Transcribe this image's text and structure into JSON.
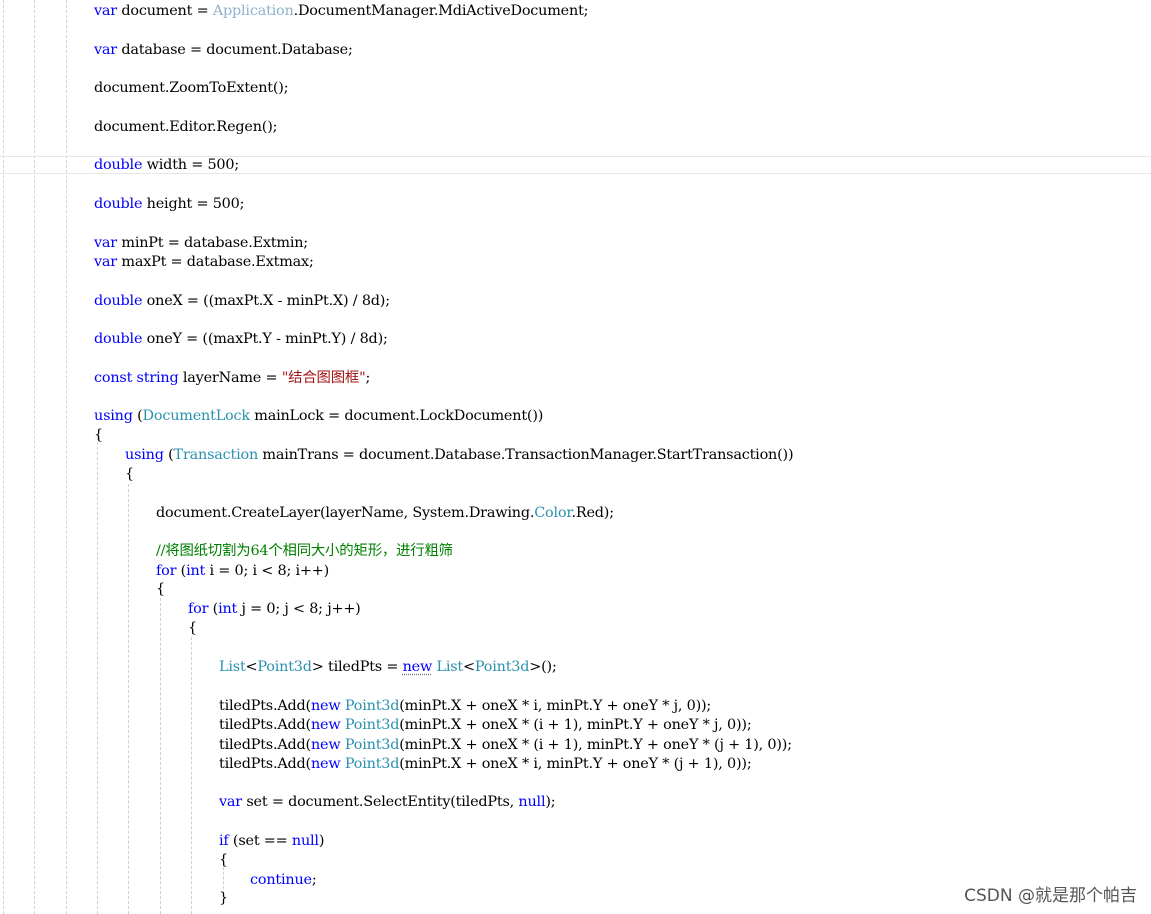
{
  "editor": {
    "lines": [
      {
        "id": "l0",
        "tokens": [
          {
            "t": "var",
            "c": "kw"
          },
          {
            "t": " document = "
          },
          {
            "t": "Application",
            "c": "type-light"
          },
          {
            "t": ".DocumentManager.MdiActiveDocument;"
          }
        ]
      },
      {
        "id": "l1",
        "tokens": [
          {
            "t": "var",
            "c": "kw"
          },
          {
            "t": " database = document.Database;"
          }
        ]
      },
      {
        "id": "l2",
        "tokens": [
          {
            "t": "document.ZoomToExtent();"
          }
        ]
      },
      {
        "id": "l3",
        "tokens": [
          {
            "t": "document.Editor.Regen();"
          }
        ]
      },
      {
        "id": "l4",
        "tokens": [
          {
            "t": "double",
            "c": "kw"
          },
          {
            "t": " width = 500;"
          }
        ]
      },
      {
        "id": "l5",
        "tokens": [
          {
            "t": "double",
            "c": "kw"
          },
          {
            "t": " height = 500;"
          }
        ]
      },
      {
        "id": "l6",
        "tokens": [
          {
            "t": "var",
            "c": "kw"
          },
          {
            "t": " minPt = database.Extmin;"
          }
        ]
      },
      {
        "id": "l7",
        "tokens": [
          {
            "t": "var",
            "c": "kw"
          },
          {
            "t": " maxPt = database.Extmax;"
          }
        ]
      },
      {
        "id": "l8",
        "tokens": [
          {
            "t": "double",
            "c": "kw"
          },
          {
            "t": " oneX = ((maxPt.X - minPt.X) / 8d);"
          }
        ]
      },
      {
        "id": "l9",
        "tokens": [
          {
            "t": "double",
            "c": "kw"
          },
          {
            "t": " oneY = ((maxPt.Y - minPt.Y) / 8d);"
          }
        ]
      },
      {
        "id": "l10",
        "tokens": [
          {
            "t": "const",
            "c": "kw"
          },
          {
            "t": " "
          },
          {
            "t": "string",
            "c": "kw"
          },
          {
            "t": " layerName = "
          },
          {
            "t": "\"结合图图框\"",
            "c": "str"
          },
          {
            "t": ";"
          }
        ]
      },
      {
        "id": "l11",
        "tokens": [
          {
            "t": "using",
            "c": "kw"
          },
          {
            "t": " ("
          },
          {
            "t": "DocumentLock",
            "c": "type"
          },
          {
            "t": " mainLock = document.LockDocument())"
          }
        ]
      },
      {
        "id": "l12",
        "tokens": [
          {
            "t": "{"
          }
        ]
      },
      {
        "id": "l13",
        "tokens": [
          {
            "t": "using",
            "c": "kw"
          },
          {
            "t": " ("
          },
          {
            "t": "Transaction",
            "c": "type"
          },
          {
            "t": " mainTrans = document.Database.TransactionManager.StartTransaction())"
          }
        ]
      },
      {
        "id": "l14",
        "tokens": [
          {
            "t": "{"
          }
        ]
      },
      {
        "id": "l15",
        "tokens": [
          {
            "t": "document.CreateLayer(layerName, System.Drawing."
          },
          {
            "t": "Color",
            "c": "type"
          },
          {
            "t": ".Red);"
          }
        ]
      },
      {
        "id": "l16",
        "tokens": [
          {
            "t": "//将图纸切割为64个相同大小的矩形，进行粗筛",
            "c": "comment"
          }
        ]
      },
      {
        "id": "l17",
        "tokens": [
          {
            "t": "for",
            "c": "kw"
          },
          {
            "t": " ("
          },
          {
            "t": "int",
            "c": "kw"
          },
          {
            "t": " i = 0; i < 8; i++)"
          }
        ]
      },
      {
        "id": "l18",
        "tokens": [
          {
            "t": "{"
          }
        ]
      },
      {
        "id": "l19",
        "tokens": [
          {
            "t": "for",
            "c": "kw"
          },
          {
            "t": " ("
          },
          {
            "t": "int",
            "c": "kw"
          },
          {
            "t": " j = 0; j < 8; j++)"
          }
        ]
      },
      {
        "id": "l20",
        "tokens": [
          {
            "t": "{"
          }
        ]
      },
      {
        "id": "l21",
        "tokens": [
          {
            "t": "List",
            "c": "type"
          },
          {
            "t": "<"
          },
          {
            "t": "Point3d",
            "c": "type"
          },
          {
            "t": "> tiledPts = "
          },
          {
            "t": "new",
            "c": "kw-sq"
          },
          {
            "t": " "
          },
          {
            "t": "List",
            "c": "type"
          },
          {
            "t": "<"
          },
          {
            "t": "Point3d",
            "c": "type"
          },
          {
            "t": ">();"
          }
        ]
      },
      {
        "id": "l22",
        "tokens": [
          {
            "t": "tiledPts.Add("
          },
          {
            "t": "new",
            "c": "kw"
          },
          {
            "t": " "
          },
          {
            "t": "Point3d",
            "c": "type"
          },
          {
            "t": "(minPt.X + oneX * i, minPt.Y + oneY * j, 0));"
          }
        ]
      },
      {
        "id": "l23",
        "tokens": [
          {
            "t": "tiledPts.Add("
          },
          {
            "t": "new",
            "c": "kw"
          },
          {
            "t": " "
          },
          {
            "t": "Point3d",
            "c": "type"
          },
          {
            "t": "(minPt.X + oneX * (i + 1), minPt.Y + oneY * j, 0));"
          }
        ]
      },
      {
        "id": "l24",
        "tokens": [
          {
            "t": "tiledPts.Add("
          },
          {
            "t": "new",
            "c": "kw"
          },
          {
            "t": " "
          },
          {
            "t": "Point3d",
            "c": "type"
          },
          {
            "t": "(minPt.X + oneX * (i + 1), minPt.Y + oneY * (j + 1), 0));"
          }
        ]
      },
      {
        "id": "l25",
        "tokens": [
          {
            "t": "tiledPts.Add("
          },
          {
            "t": "new",
            "c": "kw"
          },
          {
            "t": " "
          },
          {
            "t": "Point3d",
            "c": "type"
          },
          {
            "t": "(minPt.X + oneX * i, minPt.Y + oneY * (j + 1), 0));"
          }
        ]
      },
      {
        "id": "l26",
        "tokens": [
          {
            "t": "var",
            "c": "kw"
          },
          {
            "t": " set = document.SelectEntity(tiledPts, "
          },
          {
            "t": "null",
            "c": "kw"
          },
          {
            "t": ");"
          }
        ]
      },
      {
        "id": "l27",
        "tokens": [
          {
            "t": "if",
            "c": "kw"
          },
          {
            "t": " (set == "
          },
          {
            "t": "null",
            "c": "kw"
          },
          {
            "t": ")"
          }
        ]
      },
      {
        "id": "l28",
        "tokens": [
          {
            "t": "{"
          }
        ]
      },
      {
        "id": "l29",
        "tokens": [
          {
            "t": "continue",
            "c": "kw"
          },
          {
            "t": ";"
          }
        ]
      },
      {
        "id": "l30",
        "tokens": [
          {
            "t": "}"
          }
        ]
      }
    ]
  },
  "watermark": {
    "text": "CSDN @就是那个帕吉"
  },
  "colors": {
    "keyword": "#0000ff",
    "type": "#2b91af",
    "string": "#a31515",
    "comment": "#008000",
    "text": "#000000"
  }
}
